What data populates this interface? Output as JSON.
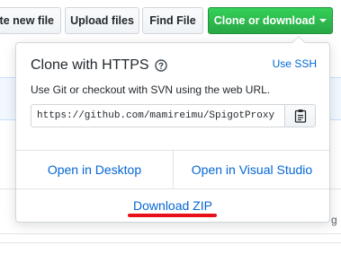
{
  "toolbar": {
    "create_file_label": "Create new file",
    "upload_files_label": "Upload files",
    "find_file_label": "Find File",
    "clone_download_label": "Clone or download"
  },
  "clone_popover": {
    "title": "Clone with HTTPS",
    "use_ssh_label": "Use SSH",
    "description": "Use Git or checkout with SVN using the web URL.",
    "clone_url": "https://github.com/mamireimu/SpigotProxy",
    "open_desktop_label": "Open in Desktop",
    "open_visual_studio_label": "Open in Visual Studio",
    "download_zip_label": "Download ZIP"
  },
  "background": {
    "truncated_text": "g"
  },
  "colors": {
    "primary_green": "#28a745",
    "link_blue": "#0366d6",
    "annotation_red": "#e8101a"
  },
  "icons": {
    "help": "question-circle-icon",
    "copy": "clipboard-icon",
    "dropdown": "caret-down-icon"
  }
}
